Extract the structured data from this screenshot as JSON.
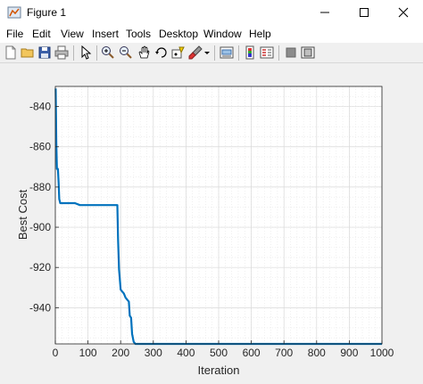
{
  "window": {
    "title": "Figure 1"
  },
  "menu": [
    "File",
    "Edit",
    "View",
    "Insert",
    "Tools",
    "Desktop",
    "Window",
    "Help"
  ],
  "toolbar_icons": [
    "new-figure-icon",
    "open-file-icon",
    "save-icon",
    "print-icon",
    "edit-plot-icon",
    "zoom-in-icon",
    "zoom-out-icon",
    "pan-icon",
    "rotate-3d-icon",
    "data-cursor-icon",
    "brush-icon",
    "brush-dropdown-icon",
    "link-plot-icon",
    "colorbar-icon",
    "legend-icon",
    "hide-plot-tools-icon",
    "show-plot-tools-icon"
  ],
  "chart_data": {
    "type": "line",
    "title": "",
    "xlabel": "Iteration",
    "ylabel": "Best Cost",
    "xlim": [
      0,
      1000
    ],
    "ylim": [
      -958,
      -830
    ],
    "xticks": [
      0,
      100,
      200,
      300,
      400,
      500,
      600,
      700,
      800,
      900,
      1000
    ],
    "yticks": [
      -840,
      -860,
      -880,
      -900,
      -920,
      -940
    ],
    "grid": true,
    "minor_grid": true,
    "series": [
      {
        "color": "#0072BD",
        "x": [
          1,
          3,
          5,
          8,
          10,
          12,
          15,
          60,
          75,
          190,
          192,
          195,
          198,
          200,
          205,
          210,
          215,
          220,
          225,
          228,
          232,
          235,
          240,
          245,
          1000
        ],
        "y": [
          -831,
          -858,
          -871,
          -871,
          -878,
          -886,
          -888,
          -888,
          -889,
          -889,
          -906,
          -921,
          -927,
          -931,
          -932,
          -933,
          -935,
          -936,
          -937,
          -944,
          -945,
          -953,
          -957,
          -958,
          -958
        ]
      }
    ]
  }
}
